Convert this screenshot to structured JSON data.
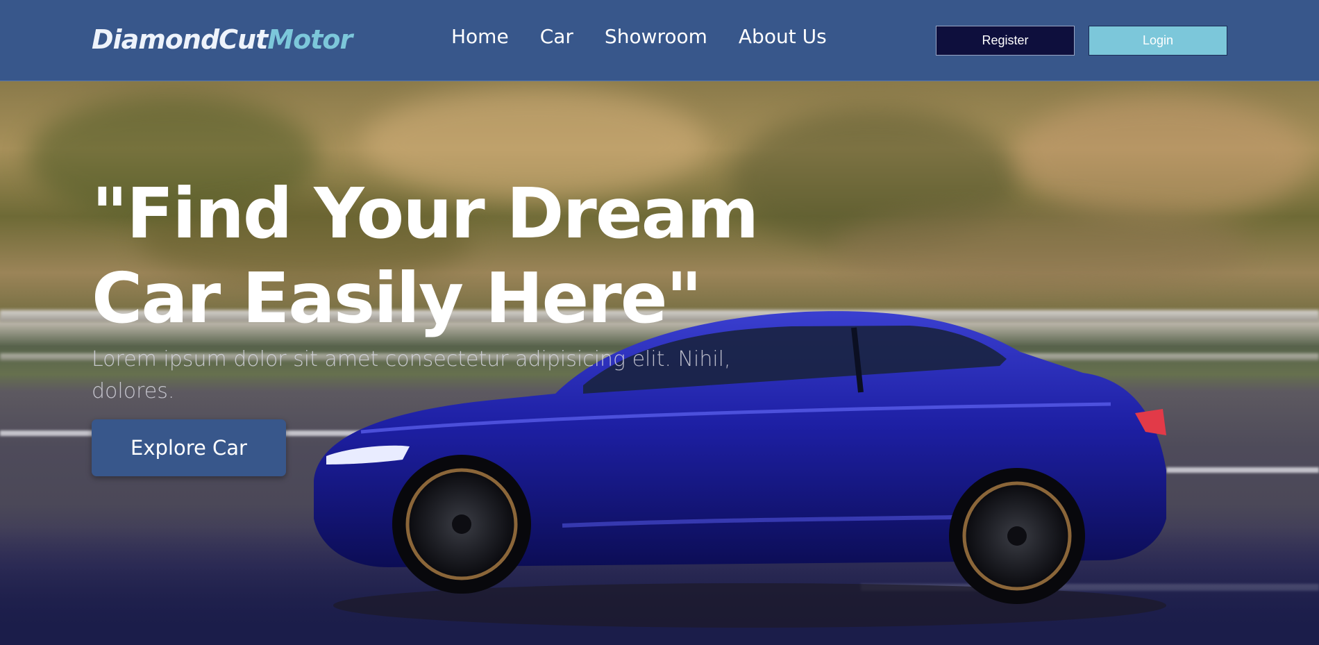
{
  "header": {
    "logo_primary": "DiamondCut",
    "logo_accent": "Motor",
    "nav": [
      {
        "label": "Home"
      },
      {
        "label": "Car"
      },
      {
        "label": "Showroom"
      },
      {
        "label": "About Us"
      }
    ],
    "register_label": "Register",
    "login_label": "Login"
  },
  "hero": {
    "headline": "\"Find Your Dream Car Easily Here\"",
    "subtext": "Lorem ipsum dolor sit amet consectetur adipisicing elit. Nihil, dolores.",
    "cta_label": "Explore Car"
  },
  "colors": {
    "header_bg": "#38578b",
    "logo_accent": "#7cc7da",
    "register_bg": "#0e0f3d",
    "login_bg": "#7cc7da",
    "cta_bg": "#38578b"
  }
}
